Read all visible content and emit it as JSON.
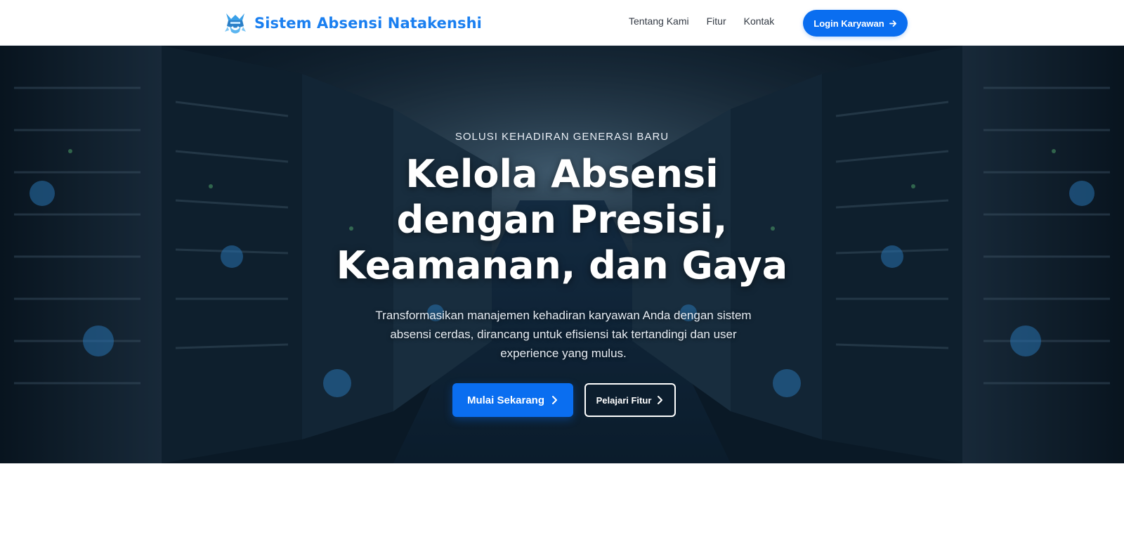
{
  "brand": {
    "name": "Sistem Absensi Natakenshi",
    "logo_icon": "samurai-helmet-icon"
  },
  "nav": {
    "links": [
      "Tentang Kami",
      "Fitur",
      "Kontak"
    ],
    "login_label": "Login Karyawan",
    "login_icon": "arrow-right-icon"
  },
  "hero": {
    "eyebrow": "SOLUSI KEHADIRAN GENERASI BARU",
    "headline_lines": [
      "Kelola Absensi",
      "dengan Presisi,",
      "Keamanan, dan Gaya"
    ],
    "subtext_lines": [
      "Transformasikan manajemen kehadiran karyawan Anda dengan sistem",
      "absensi cerdas, dirancang untuk efisiensi tak tertandingi dan user",
      "experience yang mulus."
    ],
    "primary_button": "Mulai Sekarang",
    "secondary_button": "Pelajari Fitur",
    "background": "server-room-image"
  },
  "colors": {
    "accent": "#0a6ef0",
    "brand_text": "#1a7ff0",
    "nav_text": "#333a44"
  }
}
